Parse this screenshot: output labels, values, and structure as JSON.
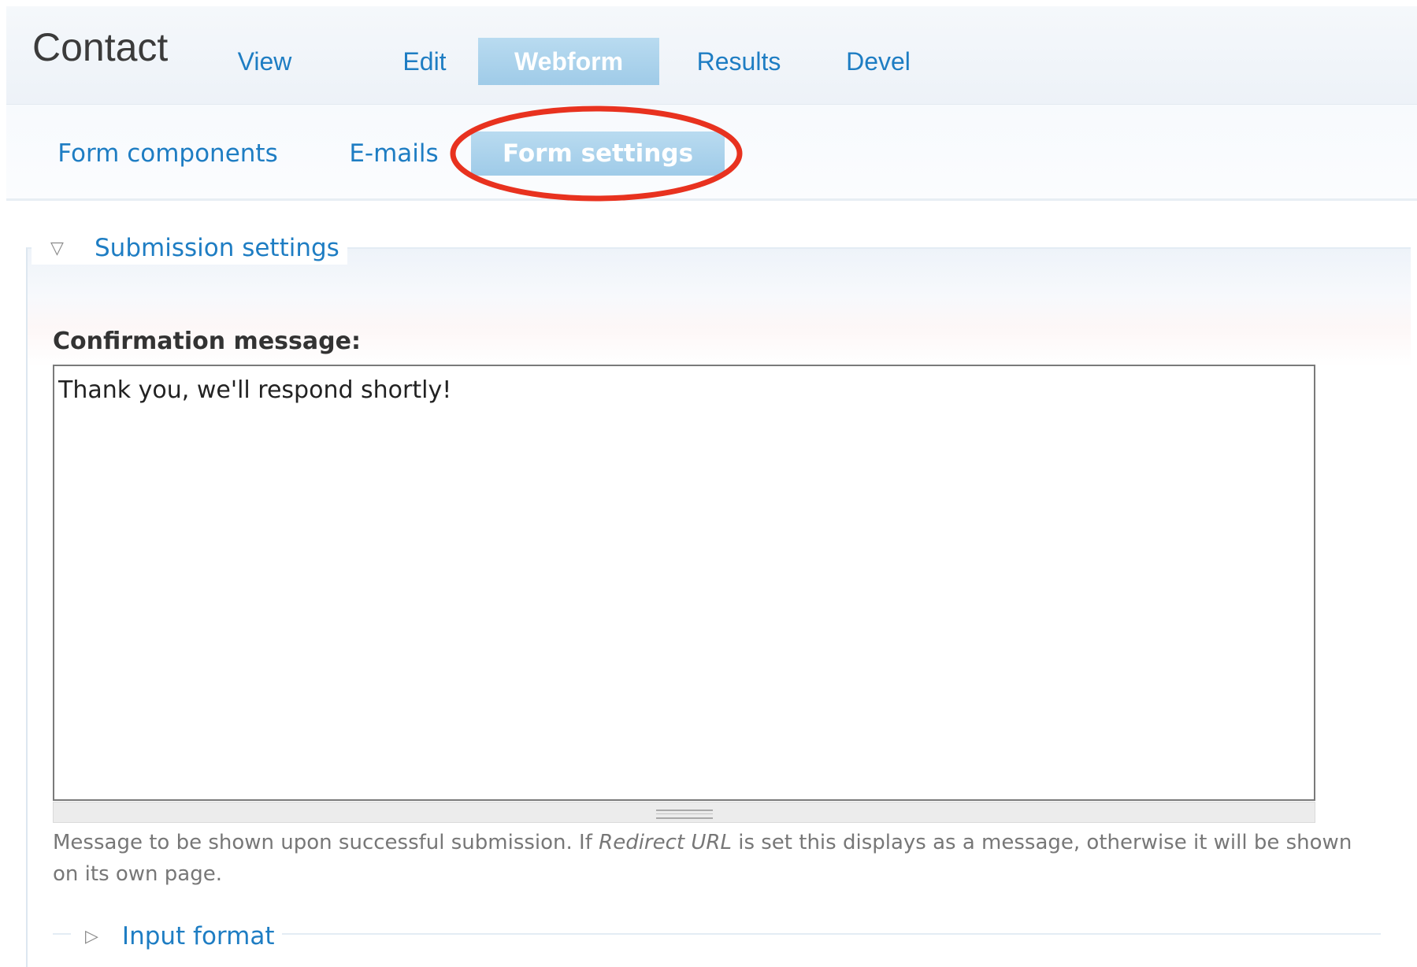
{
  "page": {
    "title": "Contact"
  },
  "primary_tabs": [
    {
      "label": "View",
      "active": false
    },
    {
      "label": "Edit",
      "active": false
    },
    {
      "label": "Webform",
      "active": true
    },
    {
      "label": "Results",
      "active": false
    },
    {
      "label": "Devel",
      "active": false
    }
  ],
  "secondary_tabs": [
    {
      "label": "Form components",
      "active": false
    },
    {
      "label": "E-mails",
      "active": false
    },
    {
      "label": "Form settings",
      "active": true
    }
  ],
  "submission_settings": {
    "legend": "Submission settings",
    "legend_icon": "triangle-down-icon",
    "confirmation": {
      "label": "Confirmation message:",
      "value": "Thank you, we'll respond shortly!"
    },
    "description": {
      "before": "Message to be shown upon successful submission. If ",
      "emphasis": "Redirect URL",
      "after": " is set this displays as a message, otherwise it will be shown on its own page."
    },
    "input_format": {
      "legend": "Input format",
      "legend_icon": "triangle-right-icon"
    }
  },
  "annotation": {
    "color": "#e8321f",
    "target": "Form settings"
  },
  "colors": {
    "link": "#1e7dc3",
    "active_tab_bg": "#a8d1ec"
  }
}
